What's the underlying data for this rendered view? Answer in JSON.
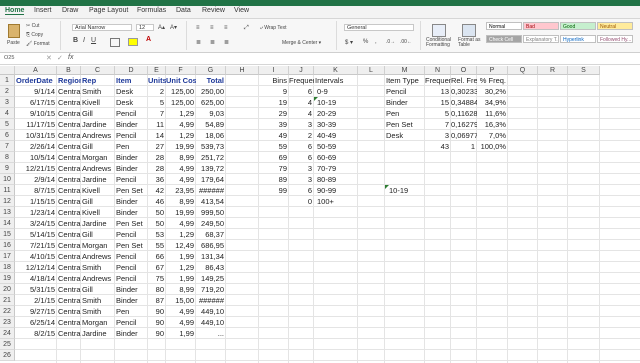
{
  "ribbon_tabs": [
    "Home",
    "Insert",
    "Draw",
    "Page Layout",
    "Formulas",
    "Data",
    "Review",
    "View"
  ],
  "clipboard": {
    "paste": "Paste",
    "cut": "Cut",
    "copy": "Copy",
    "format": "Format"
  },
  "font": {
    "name": "Arial Narrow",
    "size": "12"
  },
  "alignment": {
    "wrap": "Wrap Text",
    "merge": "Merge & Center"
  },
  "number": {
    "format": "General"
  },
  "styles_group": {
    "conditional": "Conditional Formatting",
    "format_table": "Format as Table"
  },
  "cell_styles": [
    {
      "label": "Normal",
      "bg": "#ffffff",
      "color": "#000000"
    },
    {
      "label": "Bad",
      "bg": "#ffc7ce",
      "color": "#9c0006"
    },
    {
      "label": "Good",
      "bg": "#c6efce",
      "color": "#006100"
    },
    {
      "label": "Neutral",
      "bg": "#ffeb9c",
      "color": "#9c5700"
    },
    {
      "label": "Check Cell",
      "bg": "#a5a5a5",
      "color": "#ffffff"
    },
    {
      "label": "Explanatory T...",
      "bg": "#ffffff",
      "color": "#7f7f7f"
    },
    {
      "label": "Hyperlink",
      "bg": "#ffffff",
      "color": "#0563c1"
    },
    {
      "label": "Followed Hy...",
      "bg": "#ffffff",
      "color": "#954f72"
    }
  ],
  "formula_bar": {
    "name_box": "O25",
    "fx": "fx",
    "content": ""
  },
  "columns": [
    "A",
    "B",
    "C",
    "D",
    "E",
    "F",
    "G",
    "H",
    "I",
    "J",
    "K",
    "L",
    "M",
    "N",
    "O",
    "P",
    "Q",
    "R",
    "S"
  ],
  "rows": [
    "1",
    "2",
    "3",
    "4",
    "5",
    "6",
    "7",
    "8",
    "9",
    "10",
    "11",
    "12",
    "13",
    "14",
    "15",
    "16",
    "17",
    "18",
    "19",
    "20",
    "21",
    "22",
    "23",
    "24",
    "25",
    "26"
  ],
  "headers": {
    "A": "OrderDate",
    "B": "Region",
    "C": "Rep",
    "D": "Item",
    "E": "Units",
    "F": "Unit Cost",
    "G": "Total",
    "I": "Bins",
    "J": "Frequency",
    "K": "Intervals",
    "M": "Item Type",
    "N": "Frequency",
    "O": "Rel. Freq.",
    "P": "% Freq."
  },
  "orders": [
    [
      "9/1/14",
      "Central",
      "Smith",
      "Desk",
      "2",
      "125,00",
      "250,00"
    ],
    [
      "6/17/15",
      "Central",
      "Kivell",
      "Desk",
      "5",
      "125,00",
      "625,00"
    ],
    [
      "9/10/15",
      "Central",
      "Gill",
      "Pencil",
      "7",
      "1,29",
      "9,03"
    ],
    [
      "11/17/15",
      "Central",
      "Jardine",
      "Binder",
      "11",
      "4,99",
      "54,89"
    ],
    [
      "10/31/15",
      "Central",
      "Andrews",
      "Pencil",
      "14",
      "1,29",
      "18,06"
    ],
    [
      "2/26/14",
      "Central",
      "Gill",
      "Pen",
      "27",
      "19,99",
      "539,73"
    ],
    [
      "10/5/14",
      "Central",
      "Morgan",
      "Binder",
      "28",
      "8,99",
      "251,72"
    ],
    [
      "12/21/15",
      "Central",
      "Andrews",
      "Binder",
      "28",
      "4,99",
      "139,72"
    ],
    [
      "2/9/14",
      "Central",
      "Jardine",
      "Pencil",
      "36",
      "4,99",
      "179,64"
    ],
    [
      "8/7/15",
      "Central",
      "Kivell",
      "Pen Set",
      "42",
      "23,95",
      "######"
    ],
    [
      "1/15/15",
      "Central",
      "Gill",
      "Binder",
      "46",
      "8,99",
      "413,54"
    ],
    [
      "1/23/14",
      "Central",
      "Kivell",
      "Binder",
      "50",
      "19,99",
      "999,50"
    ],
    [
      "3/24/15",
      "Central",
      "Jardine",
      "Pen Set",
      "50",
      "4,99",
      "249,50"
    ],
    [
      "5/14/15",
      "Central",
      "Gill",
      "Pencil",
      "53",
      "1,29",
      "68,37"
    ],
    [
      "7/21/15",
      "Central",
      "Morgan",
      "Pen Set",
      "55",
      "12,49",
      "686,95"
    ],
    [
      "4/10/15",
      "Central",
      "Andrews",
      "Pencil",
      "66",
      "1,99",
      "131,34"
    ],
    [
      "12/12/14",
      "Central",
      "Smith",
      "Pencil",
      "67",
      "1,29",
      "86,43"
    ],
    [
      "4/18/14",
      "Central",
      "Andrews",
      "Pencil",
      "75",
      "1,99",
      "149,25"
    ],
    [
      "5/31/15",
      "Central",
      "Gill",
      "Binder",
      "80",
      "8,99",
      "719,20"
    ],
    [
      "2/1/15",
      "Central",
      "Smith",
      "Binder",
      "87",
      "15,00",
      "######"
    ],
    [
      "9/27/15",
      "Central",
      "Smith",
      "Pen",
      "90",
      "4,99",
      "449,10"
    ],
    [
      "6/25/14",
      "Central",
      "Morgan",
      "Pencil",
      "90",
      "4,99",
      "449,10"
    ],
    [
      "8/2/15",
      "Central",
      "Jardine",
      "Binder",
      "90",
      "1,99",
      "..."
    ]
  ],
  "bins": [
    [
      "9",
      "6",
      "0-9"
    ],
    [
      "19",
      "4",
      "10-19"
    ],
    [
      "29",
      "4",
      "20-29"
    ],
    [
      "39",
      "3",
      "30-39"
    ],
    [
      "49",
      "2",
      "40-49"
    ],
    [
      "59",
      "6",
      "50-59"
    ],
    [
      "69",
      "6",
      "60-69"
    ],
    [
      "79",
      "3",
      "70-79"
    ],
    [
      "89",
      "3",
      "80-89"
    ],
    [
      "99",
      "6",
      "90-99"
    ],
    [
      "",
      "0",
      "100+"
    ]
  ],
  "item_types": [
    [
      "Pencil",
      "13",
      "0,30233",
      "30,2%"
    ],
    [
      "Binder",
      "15",
      "0,34884",
      "34,9%"
    ],
    [
      "Pen",
      "5",
      "0,11628",
      "11,6%"
    ],
    [
      "Pen Set",
      "7",
      "0,16279",
      "16,3%"
    ],
    [
      "Desk",
      "3",
      "0,06977",
      "7,0%"
    ]
  ],
  "item_totals": [
    "",
    "43",
    "1",
    "100,0%"
  ],
  "stray_cell": "10-19"
}
